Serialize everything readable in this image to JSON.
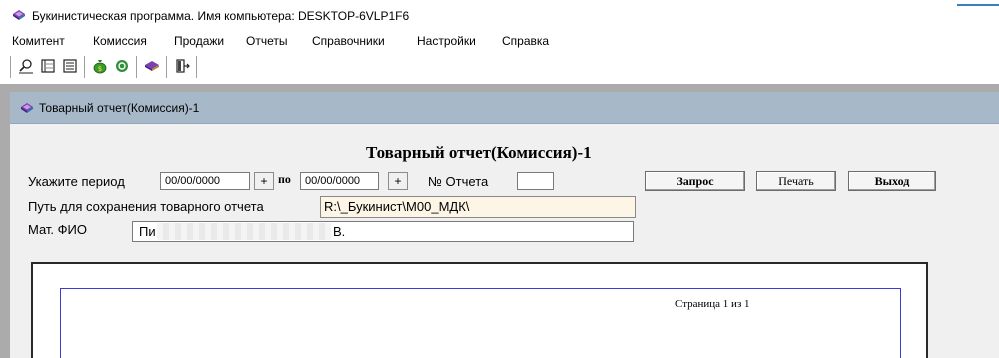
{
  "window": {
    "title": "Букинистическая программа. Имя компьютера: DESKTOP-6VLP1F6"
  },
  "menu": {
    "items": [
      "Комитент",
      "Комиссия",
      "Продажи",
      "Отчеты",
      "Справочники",
      "Настройки",
      "Справка"
    ]
  },
  "toolbar": {
    "buttons": [
      "search-person-icon",
      "register-icon",
      "document-list-icon",
      "money-bag-icon",
      "refresh-icon",
      "book-stack-icon",
      "exit-door-icon"
    ]
  },
  "child_window": {
    "title": "Товарный отчет(Комиссия)-1"
  },
  "report": {
    "heading": "Товарный отчет(Комиссия)-1",
    "period_label": "Укажите период",
    "date_from": "00/00/0000",
    "plus_label": "+",
    "to_label": "по",
    "date_to": "00/00/0000",
    "report_no_label": "№ Отчета",
    "report_no_value": "",
    "path_label": "Путь для сохранения товарного отчета",
    "path_value": "R:\\_Букинист\\М00_МДК\\",
    "mat_label": "Мат. ФИО",
    "mat_value_start": "Пи",
    "mat_value_end": "В.",
    "query_button": "Запрос",
    "print_button": "Печать",
    "exit_button": "Выход"
  },
  "preview": {
    "page_info": "Страница 1 из 1"
  },
  "colors": {
    "child_titlebar": "#a7b9c9",
    "mdi_background": "#ababab",
    "path_field": "#fdf5e6",
    "page_border": "#3b3bd6"
  }
}
